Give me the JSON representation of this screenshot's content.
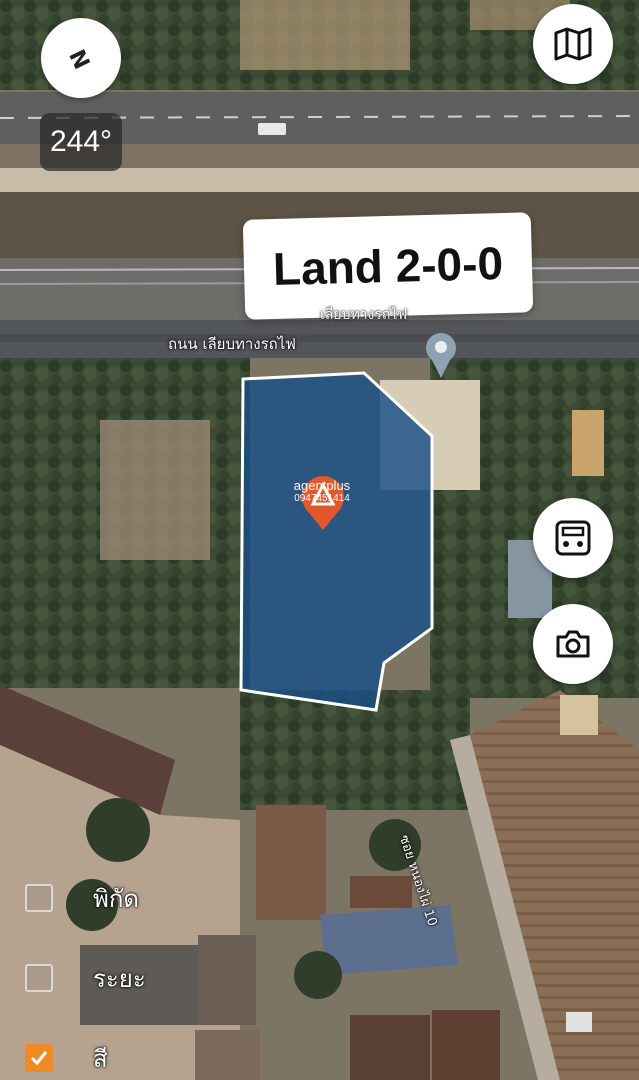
{
  "compass": {
    "icon": "compass-north-icon",
    "symbol": "N",
    "heading_text": "244°"
  },
  "map": {
    "parcel_label": "Land 2-0-0",
    "road_names": [
      "ถนน เลียบทางรถไฟ",
      "เลียบทางรถไฟ",
      "ซอย หนองไผ่ 10"
    ],
    "watermark_brand": "agentplus",
    "watermark_phone": "0947451414",
    "parcel_fill_color": "#1a4f86",
    "parcel_outline_color": "#ffffff",
    "pin_color": "#e2572b"
  },
  "controls": {
    "map_toggle_icon": "folded-map-icon",
    "calculator_icon": "calculator-icon",
    "camera_icon": "camera-icon"
  },
  "layers": [
    {
      "label": "พิกัด",
      "checked": false
    },
    {
      "label": "ระยะ",
      "checked": false
    },
    {
      "label": "สี",
      "checked": true
    }
  ],
  "accent_color": "#f08a24"
}
